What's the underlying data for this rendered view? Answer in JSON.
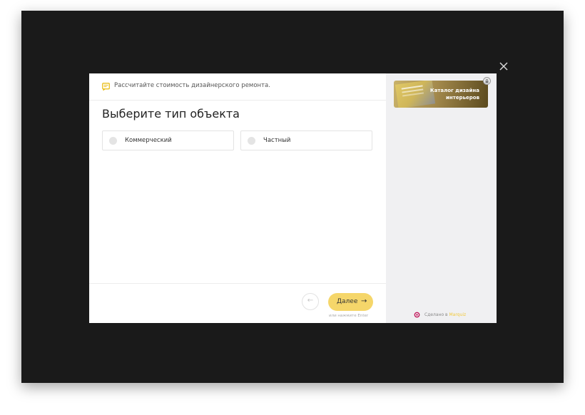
{
  "header": {
    "icon": "message-lines-icon",
    "text": "Рассчитайте стоимость дизайнерского ремонта."
  },
  "question": {
    "title": "Выберите тип объекта",
    "options": [
      {
        "label": "Коммерческий"
      },
      {
        "label": "Частный"
      }
    ]
  },
  "footer": {
    "back_symbol": "←",
    "next_label": "Далее",
    "next_arrow": "→",
    "enter_hint": "или нажмите Enter"
  },
  "sidebar": {
    "promo": {
      "title": "Каталог дизайна интерьеров"
    },
    "made_in_prefix": "Сделано в",
    "brand": "Marquiz"
  },
  "colors": {
    "accent": "#f5d66a",
    "brand": "#f2c93a",
    "overlay": "#1a1a1a"
  }
}
